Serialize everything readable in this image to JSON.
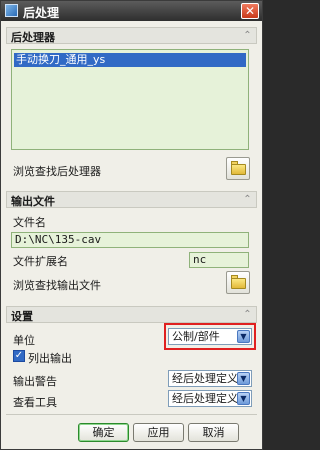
{
  "window": {
    "title": "后处理",
    "close": "✕"
  },
  "sections": {
    "postprocessor": {
      "header": "后处理器",
      "list": [
        "手动换刀_通用_ys"
      ],
      "browse_label": "浏览查找后处理器"
    },
    "output": {
      "header": "输出文件",
      "filename_label": "文件名",
      "filename_value": "D:\\NC\\135-cav",
      "ext_label": "文件扩展名",
      "ext_value": "nc",
      "browse_label": "浏览查找输出文件"
    },
    "settings": {
      "header": "设置",
      "unit_label": "单位",
      "unit_value": "公制/部件",
      "list_output_label": "列出输出",
      "warnings_label": "输出警告",
      "warnings_value": "经后处理定义",
      "review_label": "查看工具",
      "review_value": "经后处理定义"
    }
  },
  "buttons": {
    "ok": "确定",
    "apply": "应用",
    "cancel": "取消"
  },
  "icons": {
    "collapse": "chevron-up-icon",
    "folder": "folder-open-icon",
    "dropdown": "chevron-down-icon",
    "check": "checkmark-icon"
  },
  "colors": {
    "highlight": "#e02020",
    "selection": "#316ac5",
    "field_bg": "#e6f2d9"
  }
}
